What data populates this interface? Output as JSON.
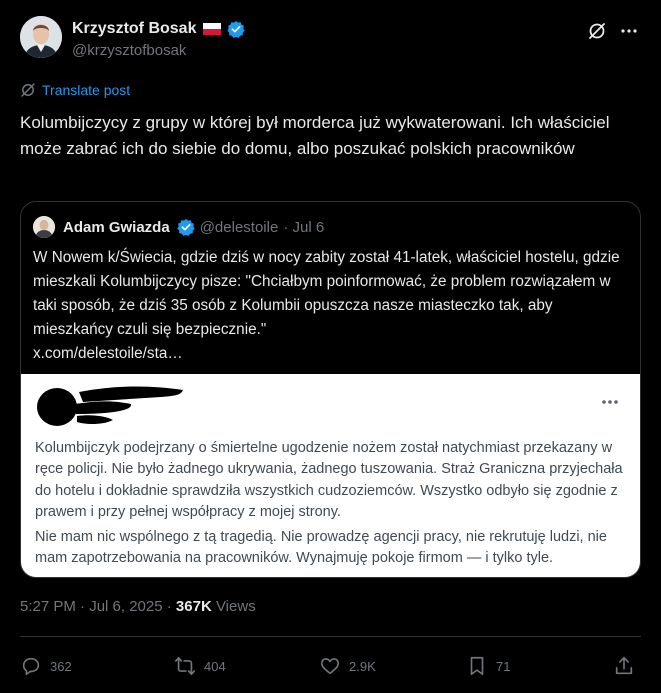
{
  "author": {
    "display_name": "Krzysztof Bosak",
    "handle": "@krzysztofbosak"
  },
  "translate_label": "Translate post",
  "tweet_text": "Kolumbijczycy z grupy w której był morderca już wykwaterowani. Ich właściciel może zabrać ich do siebie do domu, albo poszukać polskich pracowników",
  "quote": {
    "display_name": "Adam Gwiazda",
    "handle": "@delestoile",
    "date": "· Jul 6",
    "text": "W Nowem k/Świecia, gdzie dziś w nocy zabity został 41-latek, właściciel hostelu, gdzie mieszkali Kolumbijczycy pisze: \"Chciałbym poinformować, że problem rozwiązałem w taki sposób, że dziś 35 osób z Kolumbii opuszcza nasze miasteczko tak, aby mieszkańcy czuli się bezpiecznie.\"",
    "link": "x.com/delestoile/sta…",
    "image": {
      "paragraph1": "Kolumbijczyk podejrzany o śmiertelne ugodzenie nożem został natychmiast przekazany w ręce policji. Nie było żadnego ukrywania, żadnego tuszowania. Straż Graniczna przyjechała do hotelu i dokładnie sprawdziła wszystkich cudzoziemców. Wszystko odbyło się zgodnie z prawem i przy pełnej współpracy z mojej strony.",
      "paragraph2": "Nie mam nic wspólnego z tą tragedią. Nie prowadzę agencji pracy, nie rekrutuję ludzi, nie mam zapotrzebowania na pracowników. Wynajmuję pokoje firmom — i tylko tyle."
    }
  },
  "timestamp": "5:27 PM · Jul 6, 2025 · ",
  "views_count": "367K",
  "views_label": " Views",
  "actions": {
    "replies": "362",
    "reposts": "404",
    "likes": "2.9K",
    "bookmarks": "71"
  },
  "colors": {
    "background": "#000000",
    "text": "#e7e9ea",
    "muted": "#71767b",
    "accent": "#1d9bf0",
    "border": "#2f3336"
  },
  "icons": [
    "verified-badge-icon",
    "poland-flag-icon",
    "grok-icon",
    "more-icon",
    "translate-icon",
    "reply-icon",
    "repost-icon",
    "like-icon",
    "bookmark-icon",
    "share-icon"
  ]
}
